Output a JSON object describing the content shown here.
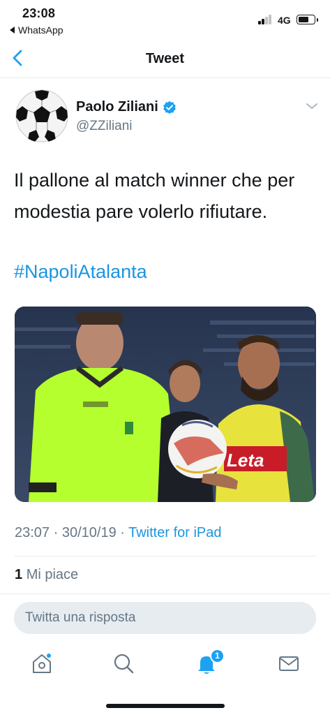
{
  "status_bar": {
    "time": "23:08",
    "back_app": "WhatsApp",
    "network": "4G",
    "battery_level": 0.7
  },
  "header": {
    "title": "Tweet"
  },
  "tweet": {
    "author_name": "Paolo Ziliani",
    "author_handle": "@ZZiliani",
    "verified": true,
    "text": "Il pallone al match winner che per modestia pare volerlo rifiutare.",
    "hashtag": "#NapoliAtalanta",
    "media_sponsor_text": "Leta",
    "meta": {
      "time": "23:07",
      "separator": " · ",
      "date": "30/10/19",
      "source": "Twitter for iPad"
    },
    "likes_count": "1",
    "likes_label": "Mi piace"
  },
  "reply": {
    "placeholder": "Twitta una risposta"
  },
  "tab_bar": {
    "notifications_badge": "1"
  },
  "colors": {
    "accent": "#1da1f2",
    "link": "#1b95e0",
    "secondary_text": "#657786",
    "primary_text": "#14171a",
    "divider": "#e6ecf0"
  }
}
